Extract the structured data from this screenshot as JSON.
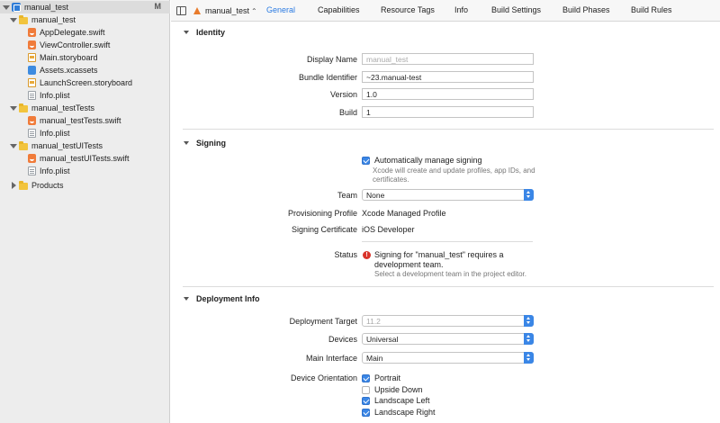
{
  "sidebar": {
    "project": {
      "label": "manual_test",
      "badge": "M"
    },
    "groups": [
      {
        "label": "manual_test",
        "items": [
          {
            "label": "AppDelegate.swift",
            "icon": "swift-file-icon"
          },
          {
            "label": "ViewController.swift",
            "icon": "swift-file-icon"
          },
          {
            "label": "Main.storyboard",
            "icon": "storyboard-icon"
          },
          {
            "label": "Assets.xcassets",
            "icon": "assets-icon"
          },
          {
            "label": "LaunchScreen.storyboard",
            "icon": "storyboard-icon"
          },
          {
            "label": "Info.plist",
            "icon": "plist-icon"
          }
        ]
      },
      {
        "label": "manual_testTests",
        "items": [
          {
            "label": "manual_testTests.swift",
            "icon": "swift-file-icon"
          },
          {
            "label": "Info.plist",
            "icon": "plist-icon"
          }
        ]
      },
      {
        "label": "manual_testUITests",
        "items": [
          {
            "label": "manual_testUITests.swift",
            "icon": "swift-file-icon"
          },
          {
            "label": "Info.plist",
            "icon": "plist-icon"
          }
        ]
      },
      {
        "label": "Products",
        "items": []
      }
    ]
  },
  "topbar": {
    "target": "manual_test",
    "tabs": [
      "General",
      "Capabilities",
      "Resource Tags",
      "Info",
      "Build Settings",
      "Build Phases",
      "Build Rules"
    ],
    "active_tab": "General"
  },
  "identity": {
    "title": "Identity",
    "display_name_label": "Display Name",
    "display_name_placeholder": "manual_test",
    "bundle_id_label": "Bundle Identifier",
    "bundle_id_value": "~23.manual-test",
    "version_label": "Version",
    "version_value": "1.0",
    "build_label": "Build",
    "build_value": "1"
  },
  "signing": {
    "title": "Signing",
    "auto_manage_label": "Automatically manage signing",
    "auto_manage_checked": true,
    "auto_manage_help": "Xcode will create and update profiles, app IDs, and certificates.",
    "team_label": "Team",
    "team_value": "None",
    "profile_label": "Provisioning Profile",
    "profile_value": "Xcode Managed Profile",
    "certificate_label": "Signing Certificate",
    "certificate_value": "iOS Developer",
    "status_label": "Status",
    "status_value": "Signing for \"manual_test\" requires a development team.",
    "status_sub": "Select a development team in the project editor."
  },
  "deployment": {
    "title": "Deployment Info",
    "target_label": "Deployment Target",
    "target_value": "11.2",
    "devices_label": "Devices",
    "devices_value": "Universal",
    "interface_label": "Main Interface",
    "interface_value": "Main",
    "orientation_label": "Device Orientation",
    "orientations": [
      {
        "label": "Portrait",
        "checked": true
      },
      {
        "label": "Upside Down",
        "checked": false
      },
      {
        "label": "Landscape Left",
        "checked": true
      },
      {
        "label": "Landscape Right",
        "checked": true
      }
    ]
  }
}
